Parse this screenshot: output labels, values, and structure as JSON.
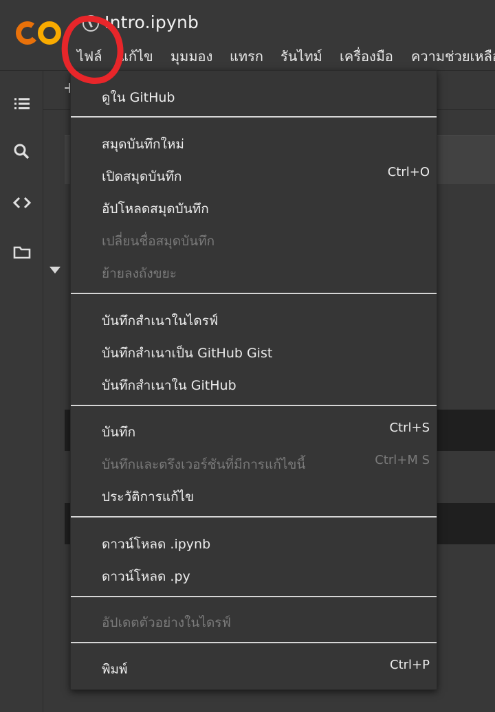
{
  "header": {
    "logo_text": "CO",
    "doc_title": "Intro.ipynb"
  },
  "menubar": {
    "items": [
      "ไฟล์",
      "แก้ไข",
      "มุมมอง",
      "แทรก",
      "รันไทม์",
      "เครื่องมือ",
      "ความช่วยเหลือ"
    ]
  },
  "toolbar": {
    "add_label": "+"
  },
  "rail": {
    "icons": [
      "toc-icon",
      "search-icon",
      "code-icon",
      "folder-icon"
    ]
  },
  "file_menu": {
    "view_github": "ดูใน GitHub",
    "new_notebook": "สมุดบันทึกใหม่",
    "open_notebook": "เปิดสมุดบันทึก",
    "open_shortcut": "Ctrl+O",
    "upload_notebook": "อัปโหลดสมุดบันทึก",
    "rename_notebook": "เปลี่ยนชื่อสมุดบันทึก",
    "move_to_trash": "ย้ายลงถังขยะ",
    "save_copy_drive": "บันทึกสำเนาในไดรฟ์",
    "save_copy_gist": "บันทึกสำเนาเป็น GitHub Gist",
    "save_copy_github": "บันทึกสำเนาใน GitHub",
    "save": "บันทึก",
    "save_shortcut": "Ctrl+S",
    "save_pin_revision": "บันทึกและตรึงเวอร์ชันที่มีการแก้ไขนี้",
    "save_pin_shortcut": "Ctrl+M S",
    "revision_history": "ประวัติการแก้ไข",
    "download_ipynb": "ดาวน์โหลด .ipynb",
    "download_py": "ดาวน์โหลด .py",
    "update_drive_preview": "อัปเดตตัวอย่างในไดรฟ์",
    "print": "พิมพ์",
    "print_shortcut": "Ctrl+P"
  },
  "colors": {
    "background": "#383838",
    "menu_background": "#363636",
    "logo_orange": "#F9AB00",
    "logo_amber": "#E8710A",
    "annotation_red": "#E8262A",
    "disabled_text": "#7a7a7a"
  }
}
